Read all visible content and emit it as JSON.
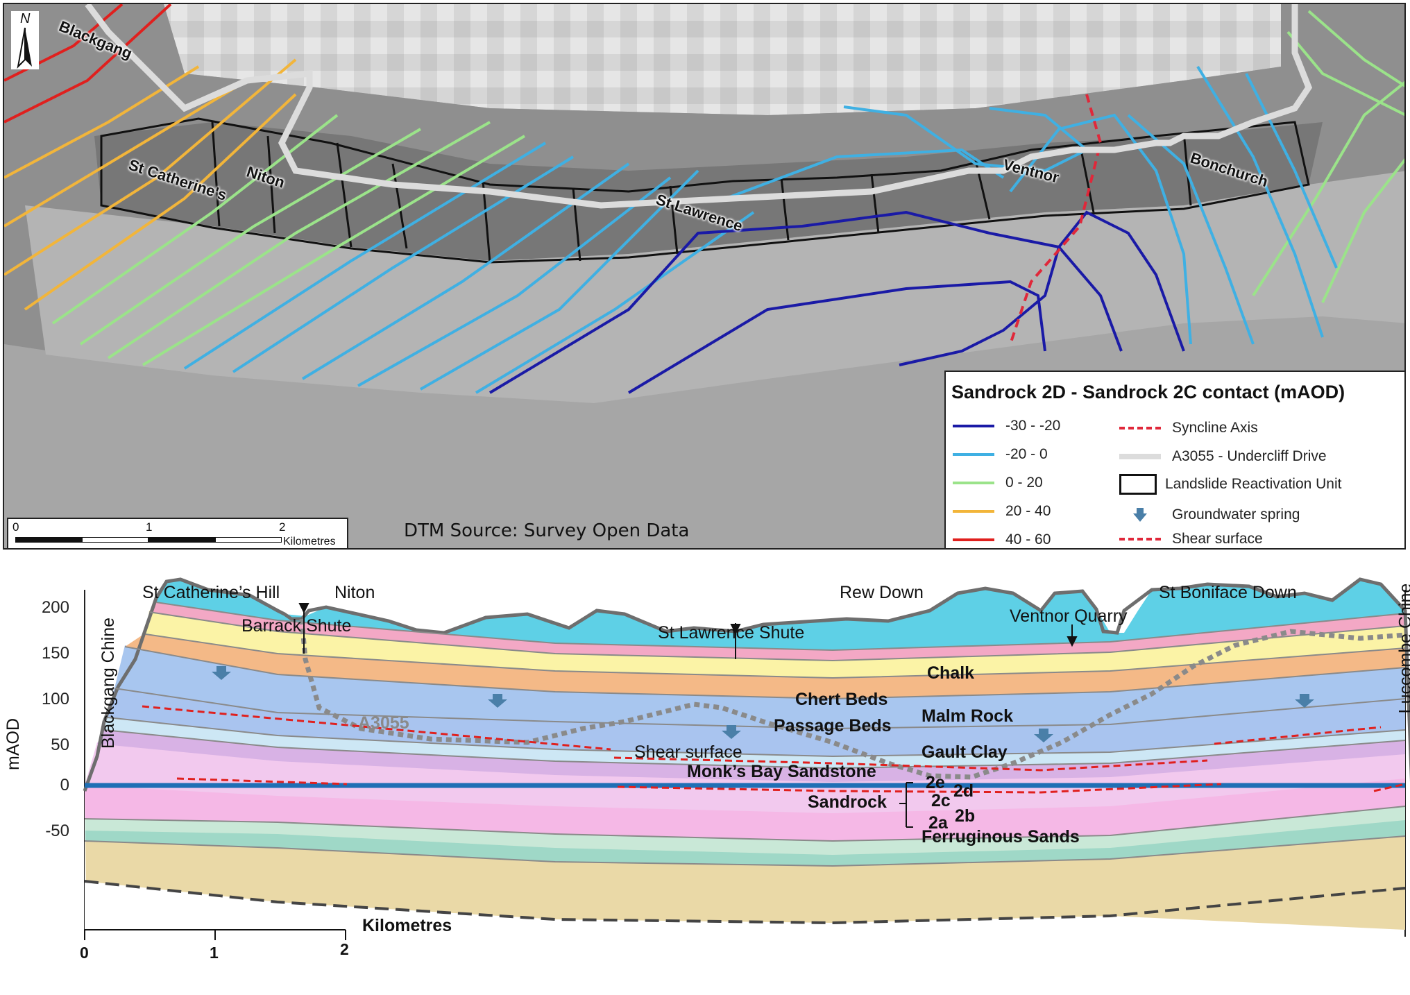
{
  "map": {
    "legend_title": "Sandrock 2D - Sandrock 2C contact (mAOD)",
    "contour_classes": [
      {
        "label": "-30 - -20",
        "color": "#1a1aa6"
      },
      {
        "label": "-20 - 0",
        "color": "#3fb0e3"
      },
      {
        "label": "0 - 20",
        "color": "#9be38a"
      },
      {
        "label": "20 - 40",
        "color": "#f2b53a"
      },
      {
        "label": "40 - 60",
        "color": "#e0201e"
      }
    ],
    "symbols": [
      {
        "label": "Syncline Axis",
        "icon": "red-dashed-line"
      },
      {
        "label": "A3055 - Undercliff Drive",
        "icon": "grey-road-line"
      },
      {
        "label": "Landslide Reactivation Unit",
        "icon": "black-outline-box"
      },
      {
        "label": "Groundwater spring",
        "icon": "blue-arrow-down-icon"
      },
      {
        "label": "Shear surface",
        "icon": "red-dashed-line"
      }
    ],
    "place_names": {
      "blackgang": "Blackgang",
      "st_catherines": "St Catherine's",
      "niton": "Niton",
      "st_lawrence": "St Lawrence",
      "ventnor": "Ventnor",
      "bonchurch": "Bonchurch"
    },
    "north": "N",
    "scale": {
      "ticks": [
        "0",
        "1",
        "2"
      ],
      "unit": "Kilometres"
    },
    "dtm_source": "DTM Source: Survey Open Data"
  },
  "section": {
    "y_axis": {
      "label": "mAOD",
      "ticks": [
        "200",
        "150",
        "100",
        "50",
        "0",
        "-50"
      ]
    },
    "top_labels": {
      "st_catherines_hill": "St Catherine’s Hill",
      "niton": "Niton",
      "rew_down": "Rew Down",
      "st_boniface_down": "St Boniface Down"
    },
    "side_labels": {
      "left": "Blackgang Chine",
      "right": "Luccombe Chine"
    },
    "features": {
      "barrack_shute": "Barrack Shute",
      "st_lawrence_shute": "St Lawrence Shute",
      "ventnor_quarry": "Ventnor Quarry",
      "a3055": "A3055",
      "shear_surface": "Shear surface"
    },
    "strata": {
      "chalk": "Chalk",
      "chert_beds": "Chert Beds",
      "malm_rock": "Malm Rock",
      "passage_beds": "Passage Beds",
      "gault_clay": "Gault Clay",
      "monks_bay": "Monk’s Bay Sandstone",
      "sandrock": "Sandrock",
      "ferruginous": "Ferruginous Sands"
    },
    "sandrock_units": {
      "u2e": "2e",
      "u2d": "2d",
      "u2c": "2c",
      "u2b": "2b",
      "u2a": "2a"
    },
    "scale": {
      "ticks": [
        "0",
        "1",
        "2"
      ],
      "unit": "Kilometres"
    }
  }
}
